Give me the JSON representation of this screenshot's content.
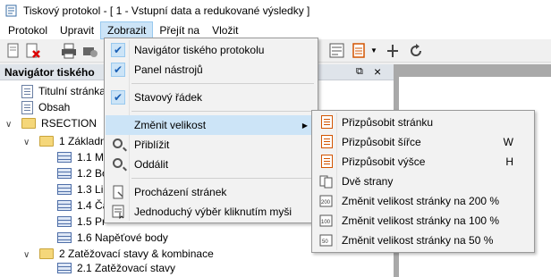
{
  "window": {
    "title": "Tiskový protokol - [ 1 - Vstupní data a redukované výsledky ]"
  },
  "menubar": {
    "items": [
      "Protokol",
      "Upravit",
      "Zobrazit",
      "Přejít na",
      "Vložit"
    ],
    "active_index": 2
  },
  "navigator": {
    "title": "Navigátor tiského",
    "tree": [
      {
        "label": "Titulní stránka",
        "icon": "document-icon"
      },
      {
        "label": "Obsah",
        "icon": "document-icon"
      },
      {
        "label": "RSECTION",
        "icon": "folder-icon",
        "expander": "∨"
      },
      {
        "label": "1 Základní",
        "icon": "folder-icon",
        "expander": "∨"
      },
      {
        "label": "1.1 Ma",
        "icon": "table-icon"
      },
      {
        "label": "1.2 Bo",
        "icon": "table-icon"
      },
      {
        "label": "1.3 Lin",
        "icon": "table-icon"
      },
      {
        "label": "1.4 Ča",
        "icon": "table-icon"
      },
      {
        "label": "1.5 Pr",
        "icon": "table-icon"
      },
      {
        "label": "1.6 Napěťové body",
        "icon": "table-icon"
      },
      {
        "label": "2 Zatěžovací stavy & kombinace",
        "icon": "folder-icon",
        "expander": "∨"
      },
      {
        "label": "2.1 Zatěžovací stavy",
        "icon": "table-icon"
      }
    ]
  },
  "view_menu": {
    "items": [
      {
        "label": "Navigátor tiského protokolu",
        "checked": true
      },
      {
        "label": "Panel nástrojů",
        "checked": true
      },
      {
        "label": "Stavový řádek",
        "checked": true
      },
      {
        "label": "Změnit velikost",
        "submenu": true,
        "highlighted": true
      },
      {
        "label": "Přiblížit",
        "icon": "zoom-in-icon"
      },
      {
        "label": "Oddálit",
        "icon": "zoom-out-icon"
      },
      {
        "label": "Procházení stránek",
        "icon": "page-browse-icon"
      },
      {
        "label": "Jednoduchý výběr kliknutím myši",
        "icon": "select-icon"
      }
    ]
  },
  "size_menu": {
    "items": [
      {
        "label": "Přizpůsobit stránku",
        "shortcut": ""
      },
      {
        "label": "Přizpůsobit šířce",
        "shortcut": "W"
      },
      {
        "label": "Přizpůsobit výšce",
        "shortcut": "H"
      },
      {
        "label": "Dvě strany",
        "shortcut": ""
      },
      {
        "label": "Změnit velikost stránky na 200 %",
        "shortcut": ""
      },
      {
        "label": "Změnit velikost stránky na 100 %",
        "shortcut": ""
      },
      {
        "label": "Změnit velikost stránky na 50 %",
        "shortcut": ""
      }
    ]
  },
  "colors": {
    "menu_highlight": "#cce4f7",
    "accent": "#99c9ef"
  }
}
